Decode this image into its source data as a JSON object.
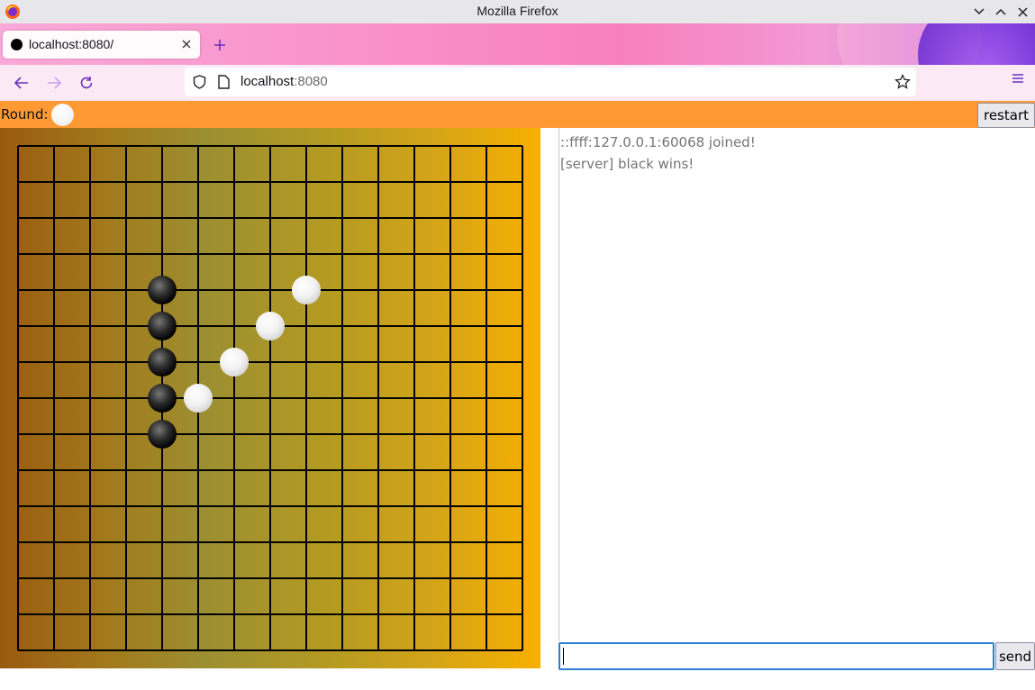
{
  "window": {
    "title": "Mozilla Firefox",
    "app_icon": "firefox-logo"
  },
  "tabs": [
    {
      "label": "localhost:8080/",
      "favicon": "black-stone-favicon",
      "active": true
    }
  ],
  "navbar": {
    "url_host": "localhost",
    "url_port": ":8080"
  },
  "game": {
    "round_label": "Round:",
    "round_color": "white",
    "restart_label": "restart",
    "board_size": 15,
    "stones": [
      {
        "color": "black",
        "col": 4,
        "row": 4
      },
      {
        "color": "black",
        "col": 4,
        "row": 5
      },
      {
        "color": "black",
        "col": 4,
        "row": 6
      },
      {
        "color": "black",
        "col": 4,
        "row": 7
      },
      {
        "color": "black",
        "col": 4,
        "row": 8
      },
      {
        "color": "white",
        "col": 8,
        "row": 4
      },
      {
        "color": "white",
        "col": 7,
        "row": 5
      },
      {
        "color": "white",
        "col": 6,
        "row": 6
      },
      {
        "color": "white",
        "col": 5,
        "row": 7
      }
    ]
  },
  "chat": {
    "messages": [
      "::ffff:127.0.0.1:60068 joined!",
      "[server] black wins!"
    ],
    "input_value": "",
    "send_label": "send"
  },
  "colors": {
    "topbar": "#ff9933",
    "focus_ring": "#2a7fd4"
  }
}
